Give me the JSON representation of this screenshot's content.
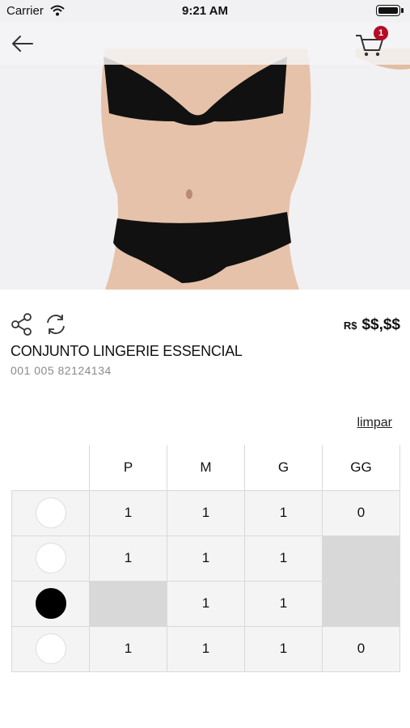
{
  "status_bar": {
    "carrier": "Carrier",
    "time": "9:21 AM"
  },
  "nav": {
    "back_icon": "arrow-left-icon",
    "cart_icon": "shopping-cart-icon",
    "cart_count": "1",
    "badge_color": "#b40d25"
  },
  "product": {
    "currency": "R$",
    "price": "$$,$$",
    "name": "CONJUNTO LINGERIE ESSENCIAL",
    "sku": "001 005 82124134"
  },
  "actions": {
    "share_icon": "share-icon",
    "refresh_icon": "refresh-icon",
    "clear_label": "limpar"
  },
  "grid": {
    "sizes": [
      "P",
      "M",
      "G",
      "GG"
    ],
    "rows": [
      {
        "color": "white",
        "cells": [
          "1",
          "1",
          "1",
          "0"
        ]
      },
      {
        "color": "white",
        "cells": [
          "1",
          "1",
          "1",
          null
        ]
      },
      {
        "color": "black",
        "cells": [
          null,
          "1",
          "1",
          null
        ]
      },
      {
        "color": "white",
        "cells": [
          "1",
          "1",
          "1",
          "0"
        ]
      }
    ]
  }
}
